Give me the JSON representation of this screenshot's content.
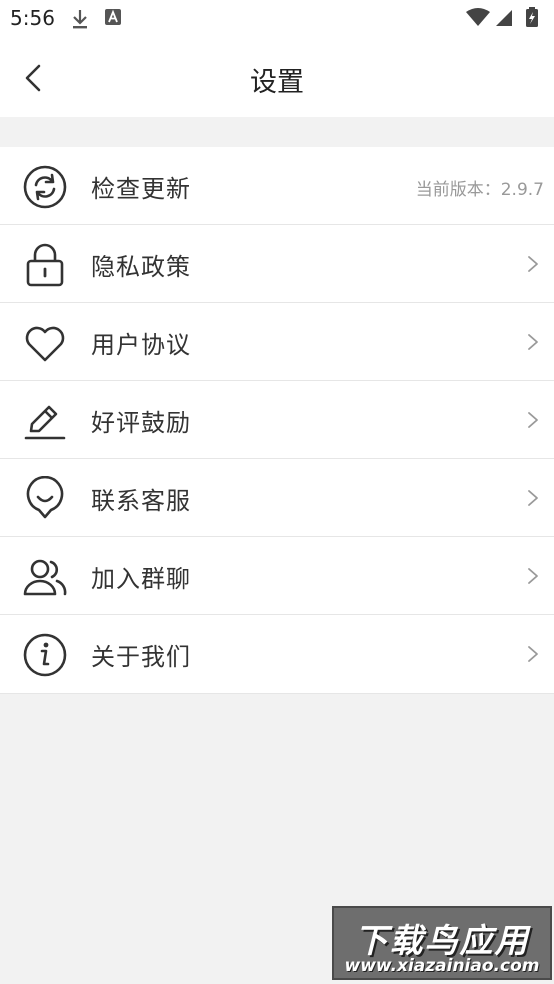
{
  "status_bar": {
    "time": "5:56"
  },
  "header": {
    "title": "设置"
  },
  "settings": {
    "items": [
      {
        "label": "检查更新",
        "icon": "refresh-icon",
        "trailing_text": "当前版本：2.9.7"
      },
      {
        "label": "隐私政策",
        "icon": "lock-icon"
      },
      {
        "label": "用户协议",
        "icon": "heart-icon"
      },
      {
        "label": "好评鼓励",
        "icon": "pencil-icon"
      },
      {
        "label": "联系客服",
        "icon": "customer-service-icon"
      },
      {
        "label": "加入群聊",
        "icon": "users-icon"
      },
      {
        "label": "关于我们",
        "icon": "info-icon"
      }
    ]
  },
  "watermark": {
    "title": "下载鸟应用",
    "url": "www.xiazainiao.com"
  }
}
